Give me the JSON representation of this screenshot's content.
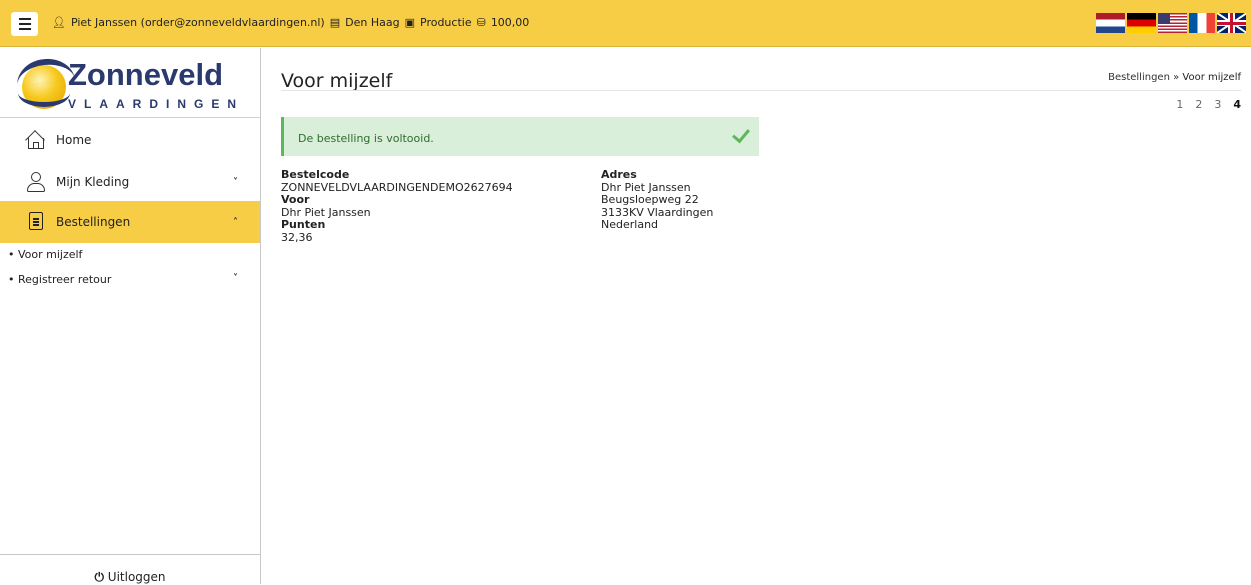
{
  "header": {
    "user": "Piet Janssen (order@zonneveldvlaardingen.nl)",
    "location": "Den Haag",
    "environment": "Productie",
    "points": "100,00",
    "bg_color": "#f6cd45"
  },
  "sidebar": {
    "logo": {
      "title": "Zonneveld",
      "subtitle": "VLAARDINGEN"
    },
    "items": [
      {
        "label": "Home"
      },
      {
        "label": "Mijn Kleding",
        "chevron": "˅"
      },
      {
        "label": "Bestellingen",
        "chevron": "˄"
      }
    ],
    "subitems": [
      {
        "label": "• Voor mijzelf"
      },
      {
        "label": "• Registreer retour",
        "chevron": "˅"
      }
    ],
    "logout": {
      "icon": "⏻",
      "label": "Uitloggen"
    }
  },
  "main": {
    "title": "Voor mijzelf",
    "breadcrumb": {
      "parent": "Bestellingen",
      "sep": " » ",
      "current": "Voor mijzelf"
    },
    "steps": [
      "1",
      "2",
      "3",
      "4"
    ],
    "alert": "De bestelling is voltooid.",
    "order": {
      "code_label": "Bestelcode",
      "code": "ZONNEVELDVLAARDINGENDEMO2627694",
      "for_label": "Voor",
      "for": "Dhr Piet Janssen",
      "points_label": "Punten",
      "points": "32,36"
    },
    "address": {
      "label": "Adres",
      "name": "Dhr Piet Janssen",
      "street": "Beugsloepweg 22",
      "city": "3133KV Vlaardingen",
      "country": "Nederland"
    }
  }
}
